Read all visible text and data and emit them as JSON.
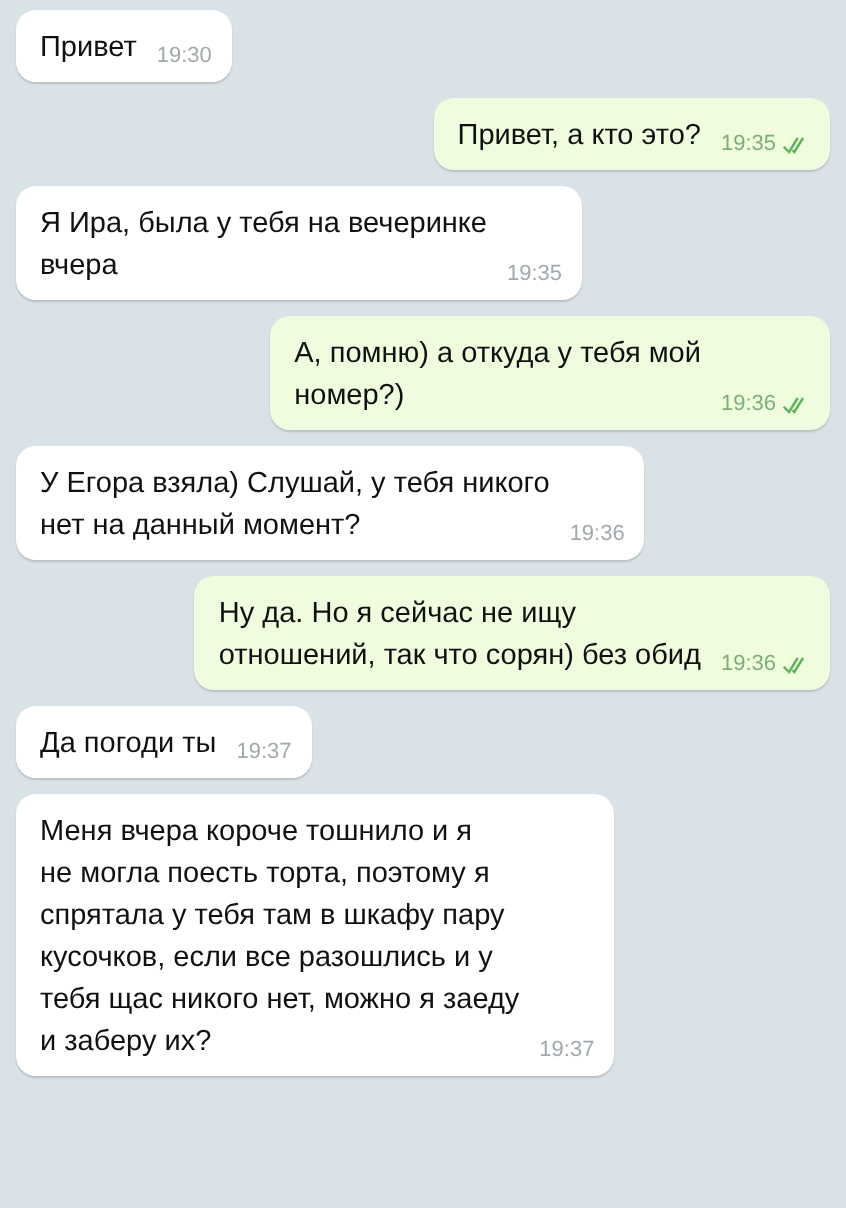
{
  "messages": [
    {
      "kind": "incoming",
      "text": "Привет",
      "time": "19:30"
    },
    {
      "kind": "outgoing",
      "text": "Привет, а кто это?",
      "time": "19:35",
      "read": true
    },
    {
      "kind": "incoming",
      "text": "Я Ира, была у тебя на вечеринке\nвчера",
      "time": "19:35"
    },
    {
      "kind": "outgoing",
      "text": "А, помню) а откуда у тебя мой\nномер?)",
      "time": "19:36",
      "read": true
    },
    {
      "kind": "incoming",
      "text": "У Егора взяла) Слушай, у тебя никого\nнет на данный момент?",
      "time": "19:36"
    },
    {
      "kind": "outgoing",
      "text": "Ну да. Но я сейчас не ищу\nотношений, так что сорян) без обид",
      "time": "19:36",
      "read": true
    },
    {
      "kind": "incoming",
      "text": "Да погоди ты",
      "time": "19:37"
    },
    {
      "kind": "incoming",
      "text": "Меня вчера короче тошнило и я\nне могла поесть торта, поэтому я\nспрятала у тебя там в шкафу пару\nкусочков, если все разошлись и у\nтебя щас никого нет,  можно я заеду\nи заберу их?",
      "time": "19:37"
    }
  ]
}
